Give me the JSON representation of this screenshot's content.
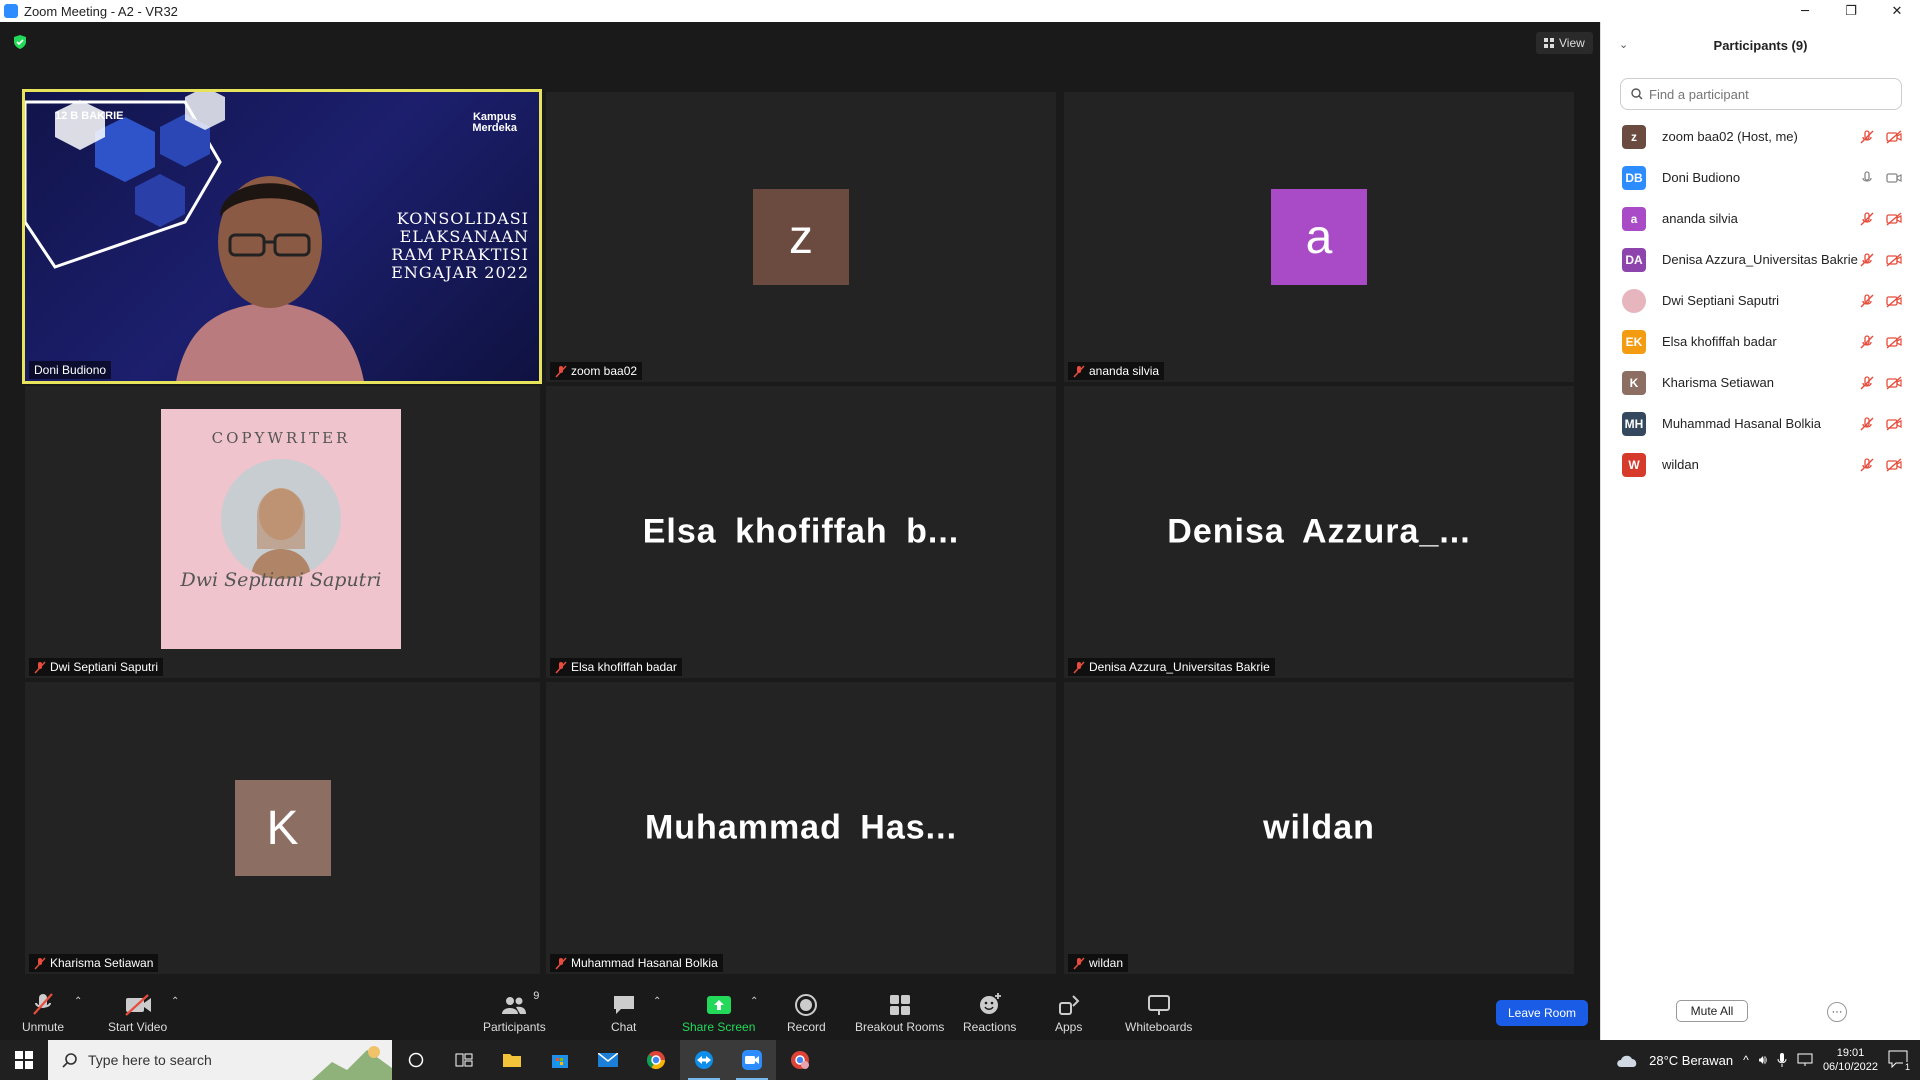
{
  "window": {
    "title": "Zoom Meeting - A2 - VR32",
    "min": "─",
    "restore": "❐",
    "close": "✕"
  },
  "view_button": "View",
  "tiles": [
    {
      "name": "Doni Budiono",
      "muted": false,
      "type": "video",
      "slide_lines": [
        "KONSOLIDASI",
        "ELAKSANAAN",
        "RAM PRAKTISI",
        "ENGAJAR 2022"
      ],
      "logo_left": "12 B BAKRIE",
      "logo_right_1": "Kampus",
      "logo_right_2": "Merdeka"
    },
    {
      "name": "zoom baa02",
      "muted": true,
      "type": "avatar",
      "letter": "z",
      "color": "#6b4a3f"
    },
    {
      "name": "ananda silvia",
      "muted": true,
      "type": "avatar",
      "letter": "a",
      "color": "#a94bc6"
    },
    {
      "name": "Dwi Septiani Saputri",
      "muted": true,
      "type": "image",
      "card_title": "COPYWRITER",
      "card_sig": "Dwi Septiani Saputri"
    },
    {
      "name": "Elsa khofiffah badar",
      "muted": true,
      "type": "text",
      "display": "Elsa khofiffah b..."
    },
    {
      "name": "Denisa Azzura_Universitas Bakrie",
      "muted": true,
      "type": "text",
      "display": "Denisa Azzura_..."
    },
    {
      "name": "Kharisma Setiawan",
      "muted": true,
      "type": "avatar",
      "letter": "K",
      "color": "#8d6e63"
    },
    {
      "name": "Muhammad Hasanal Bolkia",
      "muted": true,
      "type": "text",
      "display": "Muhammad Has..."
    },
    {
      "name": "wildan",
      "muted": true,
      "type": "text",
      "display": "wildan"
    }
  ],
  "toolbar": {
    "unmute": "Unmute",
    "start_video": "Start Video",
    "participants": "Participants",
    "participants_count": "9",
    "chat": "Chat",
    "share_screen": "Share Screen",
    "record": "Record",
    "breakout_rooms": "Breakout Rooms",
    "reactions": "Reactions",
    "apps": "Apps",
    "whiteboards": "Whiteboards",
    "leave": "Leave Room"
  },
  "panel": {
    "title": "Participants (9)",
    "search_placeholder": "Find a participant",
    "participants": [
      {
        "initials": "z",
        "name": "zoom baa02 (Host, me)",
        "color": "#6b4a3f",
        "muted": true
      },
      {
        "initials": "DB",
        "name": "Doni Budiono",
        "color": "#2d8cff",
        "muted": false
      },
      {
        "initials": "a",
        "name": "ananda silvia",
        "color": "#a94bc6",
        "muted": true
      },
      {
        "initials": "DA",
        "name": "Denisa Azzura_Universitas Bakrie",
        "color": "#8e44ad",
        "muted": true
      },
      {
        "initials": "",
        "name": "Dwi Septiani Saputri",
        "color": "#e7b5be",
        "muted": true
      },
      {
        "initials": "EK",
        "name": "Elsa khofiffah badar",
        "color": "#f39c12",
        "muted": true
      },
      {
        "initials": "K",
        "name": "Kharisma Setiawan",
        "color": "#8d6e63",
        "muted": true
      },
      {
        "initials": "MH",
        "name": "Muhammad Hasanal Bolkia",
        "color": "#34495e",
        "muted": true
      },
      {
        "initials": "W",
        "name": "wildan",
        "color": "#d63a2b",
        "muted": true
      }
    ],
    "mute_all": "Mute All",
    "more": "···"
  },
  "taskbar": {
    "search_placeholder": "Type here to search",
    "weather": "28°C  Berawan",
    "time": "19:01",
    "date": "06/10/2022",
    "notif_count": "1"
  }
}
